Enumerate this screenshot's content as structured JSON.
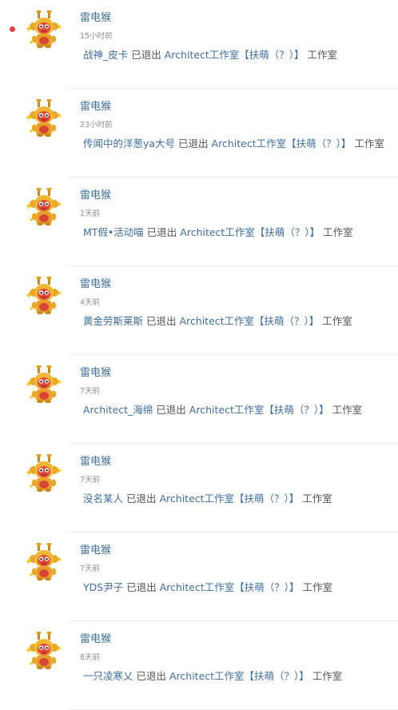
{
  "colors": {
    "link": "#3f6f9f",
    "body_text": "#555555",
    "timestamp": "#8c8c8c",
    "unread_dot": "#e94141",
    "divider": "#ececec"
  },
  "feed": {
    "items": [
      {
        "username": "雷电猴",
        "time": "15小时前",
        "actor": "战神_皮卡",
        "action": "已退出",
        "group": "Architect工作室【扶萌（？）】",
        "suffix": "工作室",
        "unread": true,
        "avatar_icon": "monkey-avatar-icon"
      },
      {
        "username": "雷电猴",
        "time": "23小时前",
        "actor": "传闻中的洋葱ya大号",
        "action": "已退出",
        "group": "Architect工作室【扶萌（？）】",
        "suffix": "工作室",
        "unread": false,
        "avatar_icon": "monkey-avatar-icon"
      },
      {
        "username": "雷电猴",
        "time": "1天前",
        "actor": "MT假•活动喵",
        "action": "已退出",
        "group": "Architect工作室【扶萌（？）】",
        "suffix": "工作室",
        "unread": false,
        "avatar_icon": "monkey-avatar-icon"
      },
      {
        "username": "雷电猴",
        "time": "4天前",
        "actor": "黄金劳斯莱斯",
        "action": "已退出",
        "group": "Architect工作室【扶萌（？）】",
        "suffix": "工作室",
        "unread": false,
        "avatar_icon": "monkey-avatar-icon"
      },
      {
        "username": "雷电猴",
        "time": "7天前",
        "actor": "Architect_海绵",
        "action": "已退出",
        "group": "Architect工作室【扶萌（？）】",
        "suffix": "工作室",
        "unread": false,
        "avatar_icon": "monkey-avatar-icon"
      },
      {
        "username": "雷电猴",
        "time": "7天前",
        "actor": "没名某人",
        "action": "已退出",
        "group": "Architect工作室【扶萌（？）】",
        "suffix": "工作室",
        "unread": false,
        "avatar_icon": "monkey-avatar-icon"
      },
      {
        "username": "雷电猴",
        "time": "7天前",
        "actor": "YDS尹子",
        "action": "已退出",
        "group": "Architect工作室【扶萌（？）】",
        "suffix": "工作室",
        "unread": false,
        "avatar_icon": "monkey-avatar-icon"
      },
      {
        "username": "雷电猴",
        "time": "8天前",
        "actor": "一只凌寒乂",
        "action": "已退出",
        "group": "Architect工作室【扶萌（？）】",
        "suffix": "工作室",
        "unread": false,
        "avatar_icon": "monkey-avatar-icon"
      }
    ]
  }
}
